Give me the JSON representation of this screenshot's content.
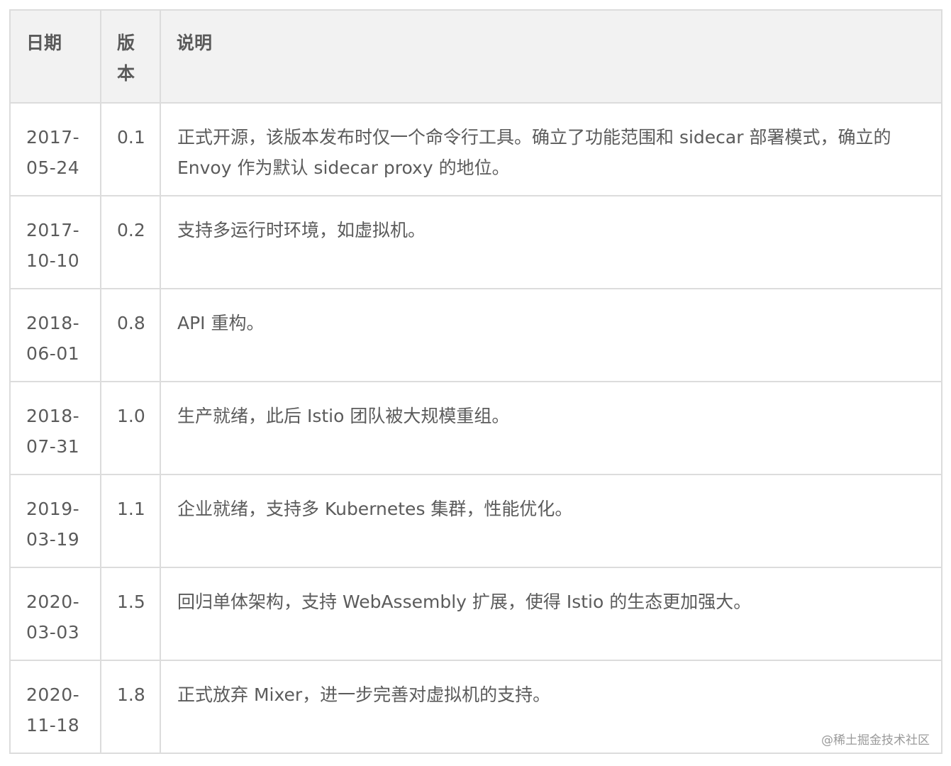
{
  "table": {
    "headers": {
      "date": "日期",
      "version": "版本",
      "description": "说明"
    },
    "rows": [
      {
        "date": "2017-05-24",
        "version": "0.1",
        "description": "正式开源，该版本发布时仅一个命令行工具。确立了功能范围和 sidecar 部署模式，确立的 Envoy 作为默认 sidecar proxy 的地位。"
      },
      {
        "date": "2017-10-10",
        "version": "0.2",
        "description": "支持多运行时环境，如虚拟机。"
      },
      {
        "date": "2018-06-01",
        "version": "0.8",
        "description": "API 重构。"
      },
      {
        "date": "2018-07-31",
        "version": "1.0",
        "description": "生产就绪，此后 Istio 团队被大规模重组。"
      },
      {
        "date": "2019-03-19",
        "version": "1.1",
        "description": "企业就绪，支持多 Kubernetes 集群，性能优化。"
      },
      {
        "date": "2020-03-03",
        "version": "1.5",
        "description": "回归单体架构，支持 WebAssembly 扩展，使得 Istio 的生态更加强大。"
      },
      {
        "date": "2020-11-18",
        "version": "1.8",
        "description": "正式放弃 Mixer，进一步完善对虚拟机的支持。"
      }
    ]
  },
  "watermark": "@稀土掘金技术社区"
}
